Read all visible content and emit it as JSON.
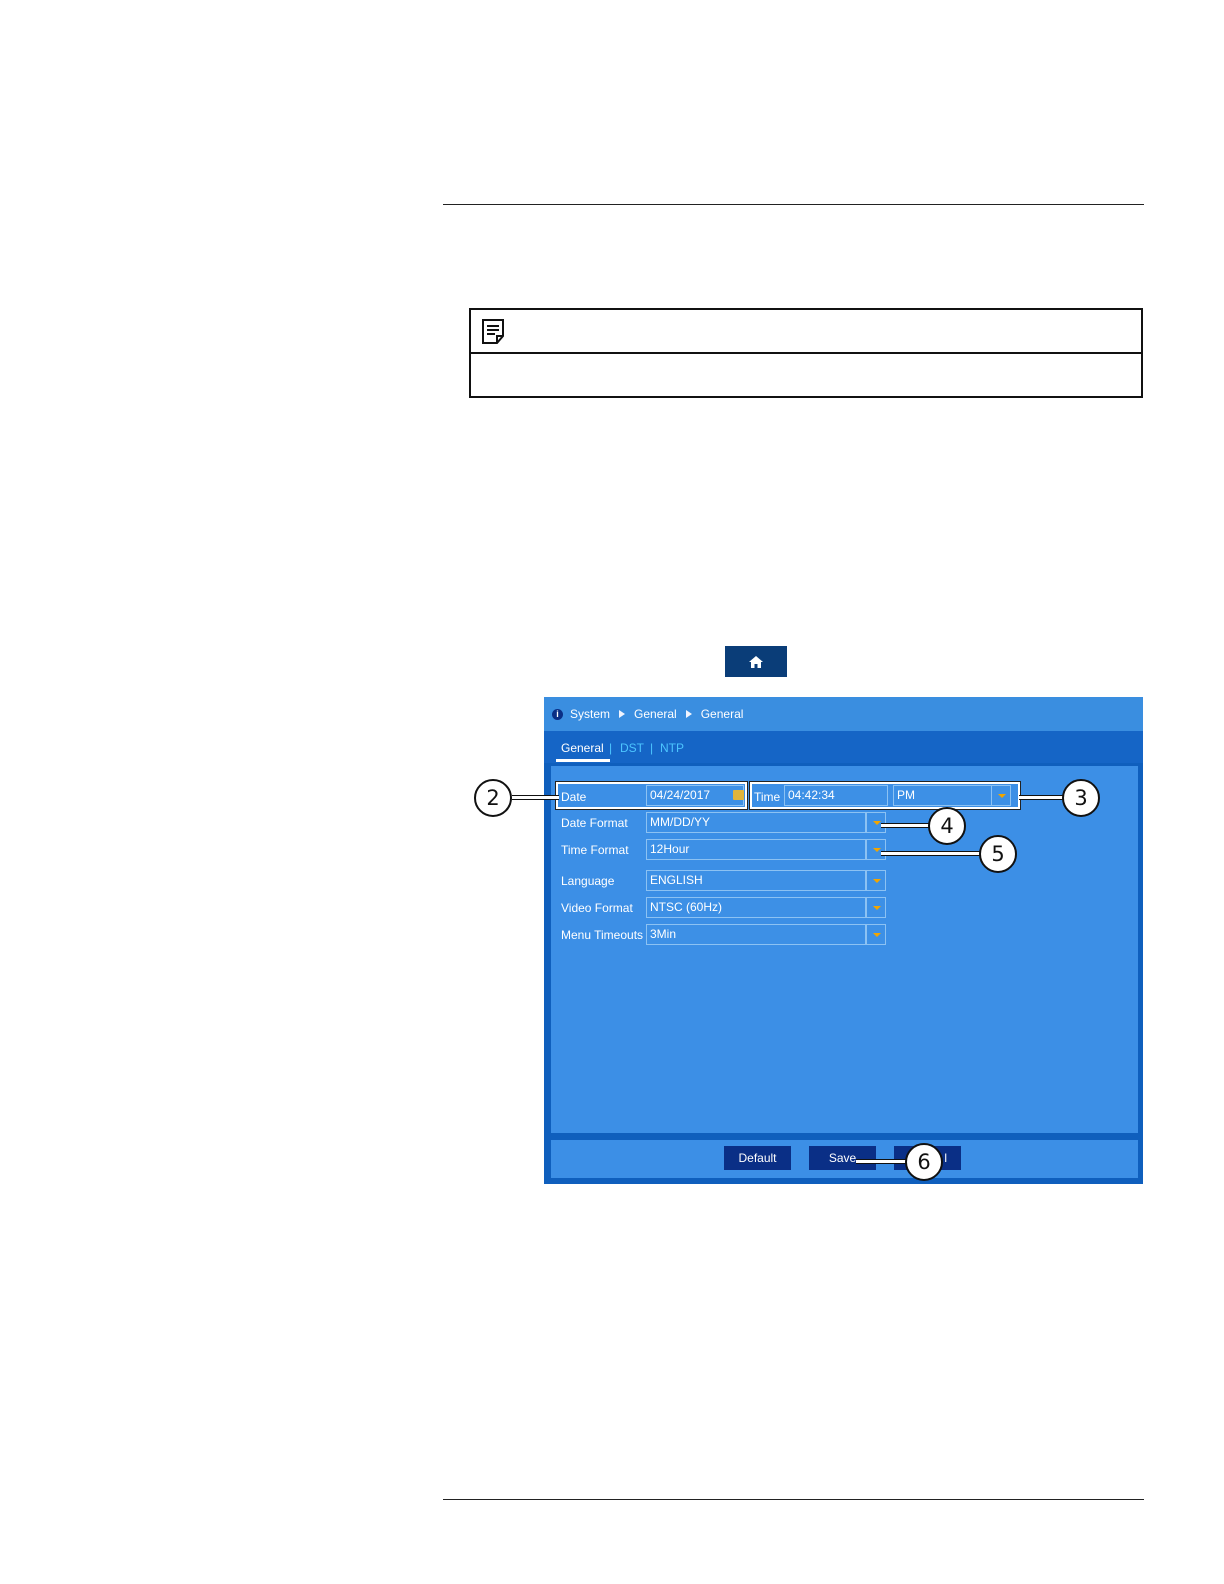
{
  "ui": {
    "breadcrumb": [
      "System",
      "General",
      "General"
    ],
    "tabs": [
      "General",
      "DST",
      "NTP"
    ],
    "tab_separator": "|",
    "fields": {
      "date": {
        "label": "Date",
        "value": "04/24/2017"
      },
      "time": {
        "label": "Time",
        "value": "04:42:34",
        "ampm": "PM"
      },
      "date_format": {
        "label": "Date Format",
        "value": "MM/DD/YY"
      },
      "time_format": {
        "label": "Time Format",
        "value": "12Hour"
      },
      "language": {
        "label": "Language",
        "value": "ENGLISH"
      },
      "video_format": {
        "label": "Video Format",
        "value": "NTSC (60Hz)"
      },
      "menu_timeouts": {
        "label": "Menu Timeouts",
        "value": "3Min"
      }
    },
    "buttons": {
      "default": "Default",
      "save": "Save",
      "cancel_partial": "l"
    }
  },
  "callouts": [
    "2",
    "3",
    "4",
    "5",
    "6"
  ],
  "icons": {
    "note": "note-icon",
    "home": "home-icon",
    "info": "info-icon",
    "calendar": "calendar-icon"
  },
  "colors": {
    "panel_bg": "#3c8fe6",
    "frame": "#0f5fbd",
    "button": "#0a2f86",
    "accent_arrow": "#f2a500",
    "tab_inactive": "#4cc5ff"
  }
}
